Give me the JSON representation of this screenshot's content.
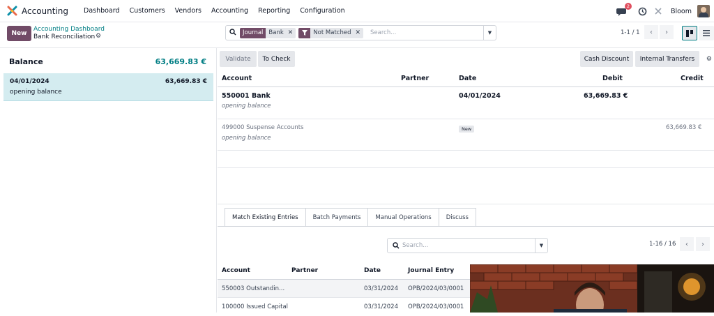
{
  "app": {
    "name": "Accounting"
  },
  "nav": [
    "Dashboard",
    "Customers",
    "Vendors",
    "Accounting",
    "Reporting",
    "Configuration"
  ],
  "topright": {
    "chat_count": "2",
    "user": "Bloom"
  },
  "control": {
    "new_label": "New",
    "breadcrumb_parent": "Accounting Dashboard",
    "breadcrumb_current": "Bank Reconciliation",
    "facet1_label": "Journal",
    "facet1_value": "Bank",
    "facet2_value": "Not Matched",
    "search_placeholder": "Search...",
    "pager": "1-1 / 1"
  },
  "left": {
    "balance_label": "Balance",
    "balance_amount": "63,669.83 €",
    "statement": {
      "date": "04/01/2024",
      "amount": "63,669.83 €",
      "label": "opening balance"
    }
  },
  "toolbar": {
    "validate": "Validate",
    "to_check": "To Check",
    "cash_discount": "Cash Discount",
    "internal_transfers": "Internal Transfers"
  },
  "table": {
    "headers": {
      "account": "Account",
      "partner": "Partner",
      "date": "Date",
      "debit": "Debit",
      "credit": "Credit"
    },
    "rows": [
      {
        "account": "550001 Bank",
        "label": "opening balance",
        "date": "04/01/2024",
        "debit": "63,669.83 €",
        "credit": ""
      },
      {
        "account": "499000 Suspense Accounts",
        "label": "opening balance",
        "badge": "New",
        "debit": "",
        "credit": "63,669.83 €"
      }
    ]
  },
  "tabs": [
    "Match Existing Entries",
    "Batch Payments",
    "Manual Operations",
    "Discuss"
  ],
  "match": {
    "search_placeholder": "Search...",
    "pager": "1-16 / 16",
    "headers": {
      "account": "Account",
      "partner": "Partner",
      "date": "Date",
      "journal_entry": "Journal Entry"
    },
    "rows": [
      {
        "account": "550003 Outstandin...",
        "date": "03/31/2024",
        "entry": "OPB/2024/03/0001"
      },
      {
        "account": "100000 Issued Capital",
        "date": "03/31/2024",
        "entry": "OPB/2024/03/0001"
      }
    ]
  },
  "colors": {
    "brand": "#714b67",
    "teal": "#017e84",
    "selected_row": "#d4ecf0"
  }
}
